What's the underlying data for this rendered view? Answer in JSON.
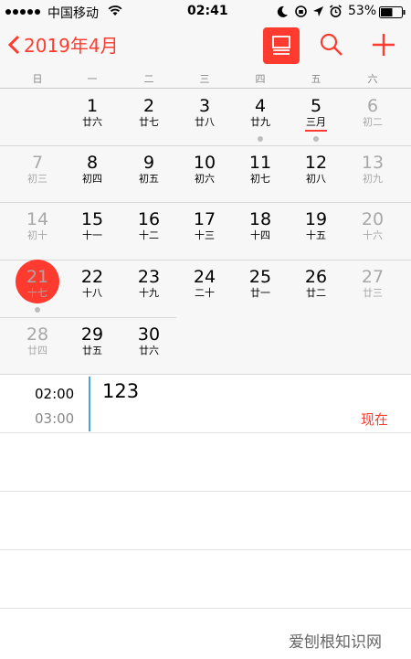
{
  "status_bar": {
    "carrier": "中国移动",
    "time": "02:41",
    "battery": "53%"
  },
  "nav": {
    "title": "2019年4月",
    "back_icon": "chevron-left-icon",
    "list_icon": "list-view-icon",
    "search_icon": "search-icon",
    "add_icon": "plus-icon"
  },
  "weekdays": [
    "日",
    "一",
    "二",
    "三",
    "四",
    "五",
    "六"
  ],
  "weeks": [
    [
      null,
      {
        "n": "1",
        "l": "廿六"
      },
      {
        "n": "2",
        "l": "廿七"
      },
      {
        "n": "3",
        "l": "廿八"
      },
      {
        "n": "4",
        "l": "廿九",
        "dot": true
      },
      {
        "n": "5",
        "l": "三月",
        "dot": true,
        "underline": true
      },
      {
        "n": "6",
        "l": "初二"
      }
    ],
    [
      {
        "n": "7",
        "l": "初三"
      },
      {
        "n": "8",
        "l": "初四"
      },
      {
        "n": "9",
        "l": "初五"
      },
      {
        "n": "10",
        "l": "初六"
      },
      {
        "n": "11",
        "l": "初七"
      },
      {
        "n": "12",
        "l": "初八"
      },
      {
        "n": "13",
        "l": "初九"
      }
    ],
    [
      {
        "n": "14",
        "l": "初十"
      },
      {
        "n": "15",
        "l": "十一"
      },
      {
        "n": "16",
        "l": "十二"
      },
      {
        "n": "17",
        "l": "十三"
      },
      {
        "n": "18",
        "l": "十四"
      },
      {
        "n": "19",
        "l": "十五"
      },
      {
        "n": "20",
        "l": "十六"
      }
    ],
    [
      {
        "n": "21",
        "l": "十七",
        "today": true,
        "dot": true
      },
      {
        "n": "22",
        "l": "十八"
      },
      {
        "n": "23",
        "l": "十九"
      },
      {
        "n": "24",
        "l": "二十"
      },
      {
        "n": "25",
        "l": "廿一"
      },
      {
        "n": "26",
        "l": "廿二"
      },
      {
        "n": "27",
        "l": "廿三"
      }
    ],
    [
      {
        "n": "28",
        "l": "廿四"
      },
      {
        "n": "29",
        "l": "廿五"
      },
      {
        "n": "30",
        "l": "廿六"
      },
      null,
      null,
      null,
      null
    ]
  ],
  "events": {
    "start_time": "02:00",
    "end_time": "03:00",
    "title": "123",
    "now_label": "现在"
  },
  "watermark": "爱刨根知识网",
  "colors": {
    "accent": "#ff3b30",
    "event_bar": "#4aa3df",
    "weekend_text": "#a8a8a8"
  }
}
